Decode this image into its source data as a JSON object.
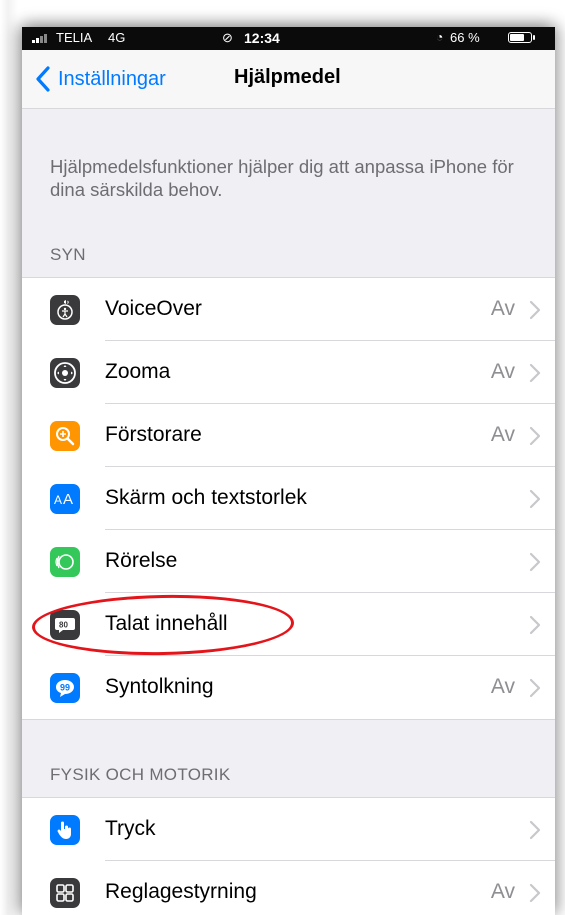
{
  "status_bar": {
    "carrier": "TELIA",
    "network": "4G",
    "time": "12:34",
    "battery": "66 %"
  },
  "nav": {
    "back_label": "Inställningar",
    "title": "Hjälpmedel"
  },
  "intro_text": "Hjälpmedelsfunktioner hjälper dig att anpassa iPhone för dina särskilda behov.",
  "sections": {
    "syn": {
      "header": "SYN",
      "items": [
        {
          "label": "VoiceOver",
          "value": "Av",
          "icon": "voiceover-icon",
          "icon_color": "#3a3a3c"
        },
        {
          "label": "Zooma",
          "value": "Av",
          "icon": "zoom-icon",
          "icon_color": "#3a3a3c"
        },
        {
          "label": "Förstorare",
          "value": "Av",
          "icon": "magnifier-icon",
          "icon_color": "#ff9500"
        },
        {
          "label": "Skärm och textstorlek",
          "value": "",
          "icon": "text-size-icon",
          "icon_color": "#007aff"
        },
        {
          "label": "Rörelse",
          "value": "",
          "icon": "motion-icon",
          "icon_color": "#34c759"
        },
        {
          "label": "Talat innehåll",
          "value": "",
          "icon": "spoken-content-icon",
          "icon_color": "#3a3a3c"
        },
        {
          "label": "Syntolkning",
          "value": "Av",
          "icon": "audio-description-icon",
          "icon_color": "#007aff"
        }
      ]
    },
    "fysik": {
      "header": "FYSIK OCH MOTORIK",
      "items": [
        {
          "label": "Tryck",
          "value": "",
          "icon": "touch-icon",
          "icon_color": "#007aff"
        },
        {
          "label": "Reglagestyrning",
          "value": "Av",
          "icon": "switch-control-icon",
          "icon_color": "#3a3a3c"
        }
      ]
    }
  },
  "colors": {
    "accent": "#007aff",
    "annotation": "#e3151b",
    "background": "#efeff4"
  }
}
